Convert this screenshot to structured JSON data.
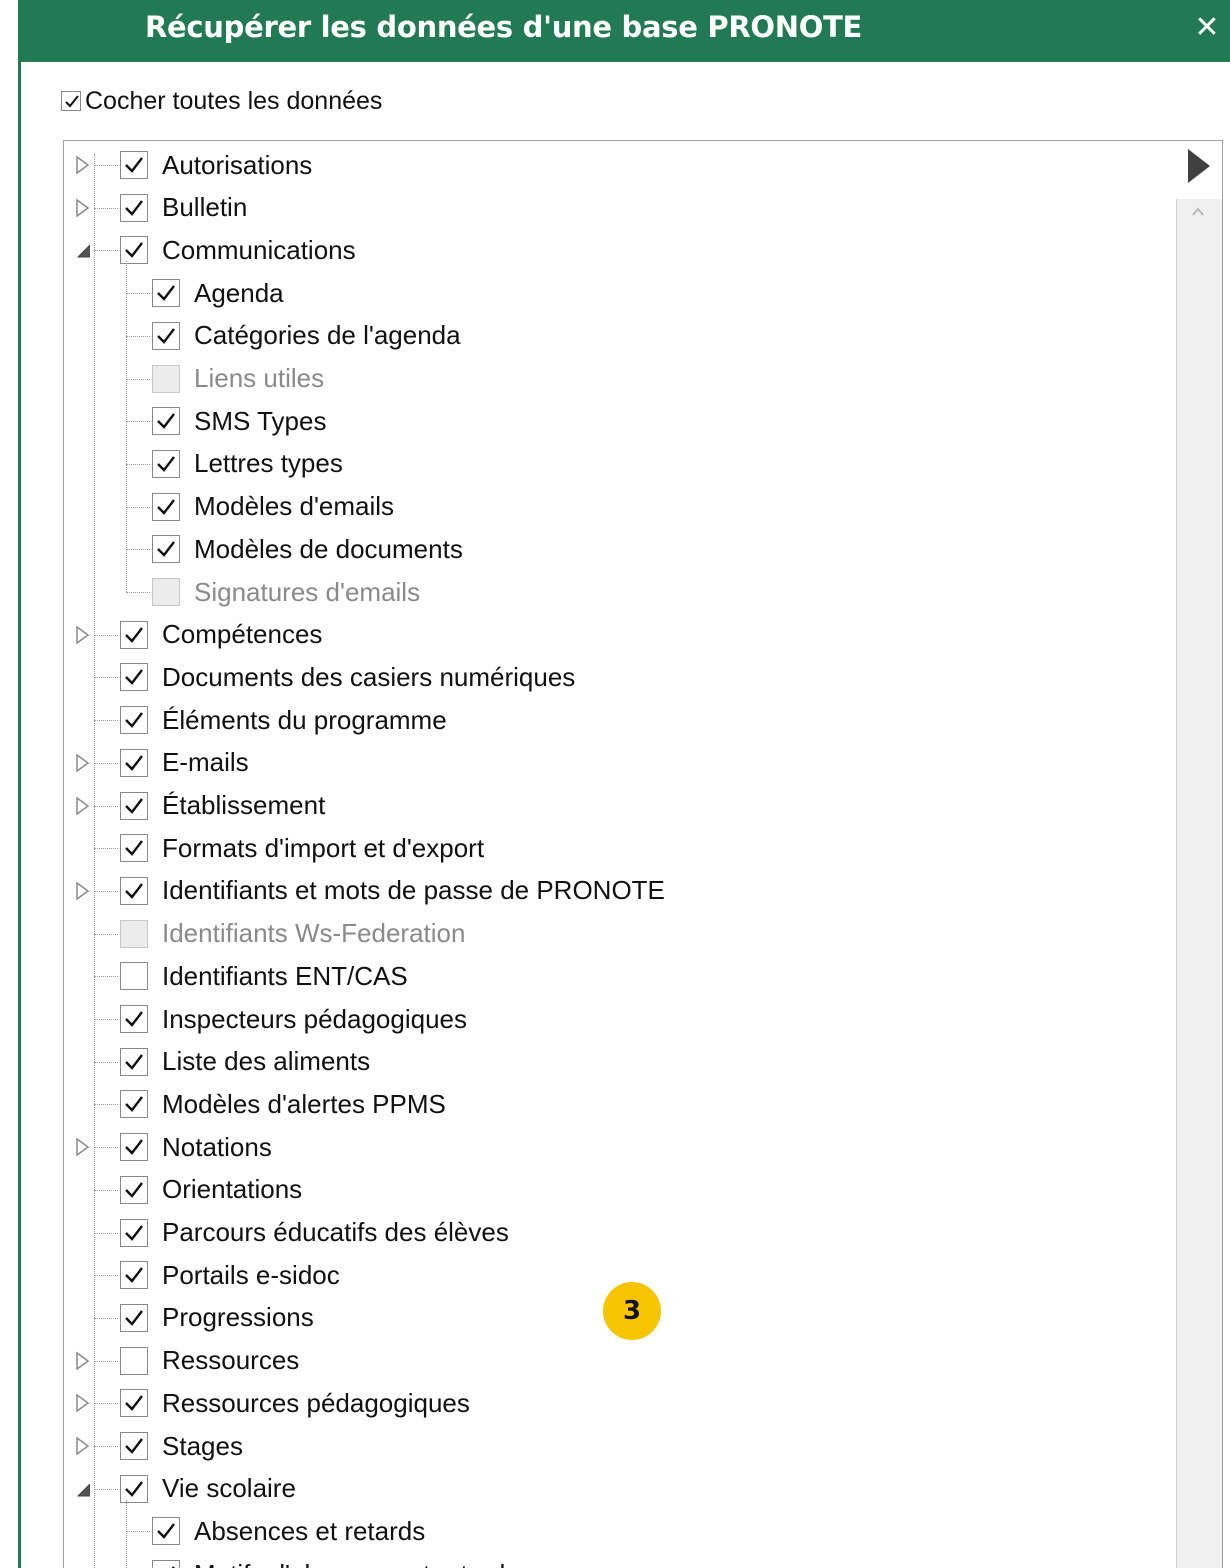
{
  "window": {
    "title": "Récupérer les données d'une base PRONOTE",
    "close_glyph": "✕",
    "accent": "#217a54"
  },
  "check_all": {
    "label": "Cocher toutes les données",
    "checked": true
  },
  "tree": [
    {
      "label": "Autorisations",
      "level": 0,
      "state": "checked",
      "toggle": "collapsed"
    },
    {
      "label": "Bulletin",
      "level": 0,
      "state": "checked",
      "toggle": "collapsed"
    },
    {
      "label": "Communications",
      "level": 0,
      "state": "checked",
      "toggle": "expanded"
    },
    {
      "label": "Agenda",
      "level": 1,
      "state": "checked",
      "toggle": "none"
    },
    {
      "label": "Catégories de l'agenda",
      "level": 1,
      "state": "checked",
      "toggle": "none"
    },
    {
      "label": "Liens utiles",
      "level": 1,
      "state": "disabled",
      "toggle": "none"
    },
    {
      "label": "SMS Types",
      "level": 1,
      "state": "checked",
      "toggle": "none"
    },
    {
      "label": "Lettres types",
      "level": 1,
      "state": "checked",
      "toggle": "none"
    },
    {
      "label": "Modèles d'emails",
      "level": 1,
      "state": "checked",
      "toggle": "none"
    },
    {
      "label": "Modèles de documents",
      "level": 1,
      "state": "checked",
      "toggle": "none"
    },
    {
      "label": "Signatures d'emails",
      "level": 1,
      "state": "disabled",
      "toggle": "none"
    },
    {
      "label": "Compétences",
      "level": 0,
      "state": "checked",
      "toggle": "collapsed"
    },
    {
      "label": "Documents des casiers numériques",
      "level": 0,
      "state": "checked",
      "toggle": "none"
    },
    {
      "label": "Éléments du programme",
      "level": 0,
      "state": "checked",
      "toggle": "none"
    },
    {
      "label": "E-mails",
      "level": 0,
      "state": "checked",
      "toggle": "collapsed"
    },
    {
      "label": "Établissement",
      "level": 0,
      "state": "checked",
      "toggle": "collapsed"
    },
    {
      "label": "Formats d'import et d'export",
      "level": 0,
      "state": "checked",
      "toggle": "none"
    },
    {
      "label": "Identifiants et mots de passe de PRONOTE",
      "level": 0,
      "state": "checked",
      "toggle": "collapsed"
    },
    {
      "label": "Identifiants Ws-Federation",
      "level": 0,
      "state": "disabled",
      "toggle": "none"
    },
    {
      "label": "Identifiants ENT/CAS",
      "level": 0,
      "state": "unchecked",
      "toggle": "none"
    },
    {
      "label": "Inspecteurs pédagogiques",
      "level": 0,
      "state": "checked",
      "toggle": "none"
    },
    {
      "label": "Liste des aliments",
      "level": 0,
      "state": "checked",
      "toggle": "none"
    },
    {
      "label": "Modèles d'alertes PPMS",
      "level": 0,
      "state": "checked",
      "toggle": "none"
    },
    {
      "label": "Notations",
      "level": 0,
      "state": "checked",
      "toggle": "collapsed"
    },
    {
      "label": "Orientations",
      "level": 0,
      "state": "checked",
      "toggle": "none"
    },
    {
      "label": "Parcours éducatifs des élèves",
      "level": 0,
      "state": "checked",
      "toggle": "none"
    },
    {
      "label": "Portails e-sidoc",
      "level": 0,
      "state": "checked",
      "toggle": "none"
    },
    {
      "label": "Progressions",
      "level": 0,
      "state": "checked",
      "toggle": "none"
    },
    {
      "label": "Ressources",
      "level": 0,
      "state": "unchecked",
      "toggle": "collapsed"
    },
    {
      "label": "Ressources pédagogiques",
      "level": 0,
      "state": "checked",
      "toggle": "collapsed"
    },
    {
      "label": "Stages",
      "level": 0,
      "state": "checked",
      "toggle": "collapsed"
    },
    {
      "label": "Vie scolaire",
      "level": 0,
      "state": "checked",
      "toggle": "expanded"
    },
    {
      "label": "Absences et retards",
      "level": 1,
      "state": "checked",
      "toggle": "none"
    },
    {
      "label": "Motifs d'absences et retards",
      "level": 1,
      "state": "checked",
      "toggle": "none"
    }
  ],
  "icons": {
    "scroll_right": "play-arrow-icon",
    "scroll_up": "chevron-up-icon"
  },
  "callout": {
    "number": "3",
    "color": "#f6c400"
  }
}
